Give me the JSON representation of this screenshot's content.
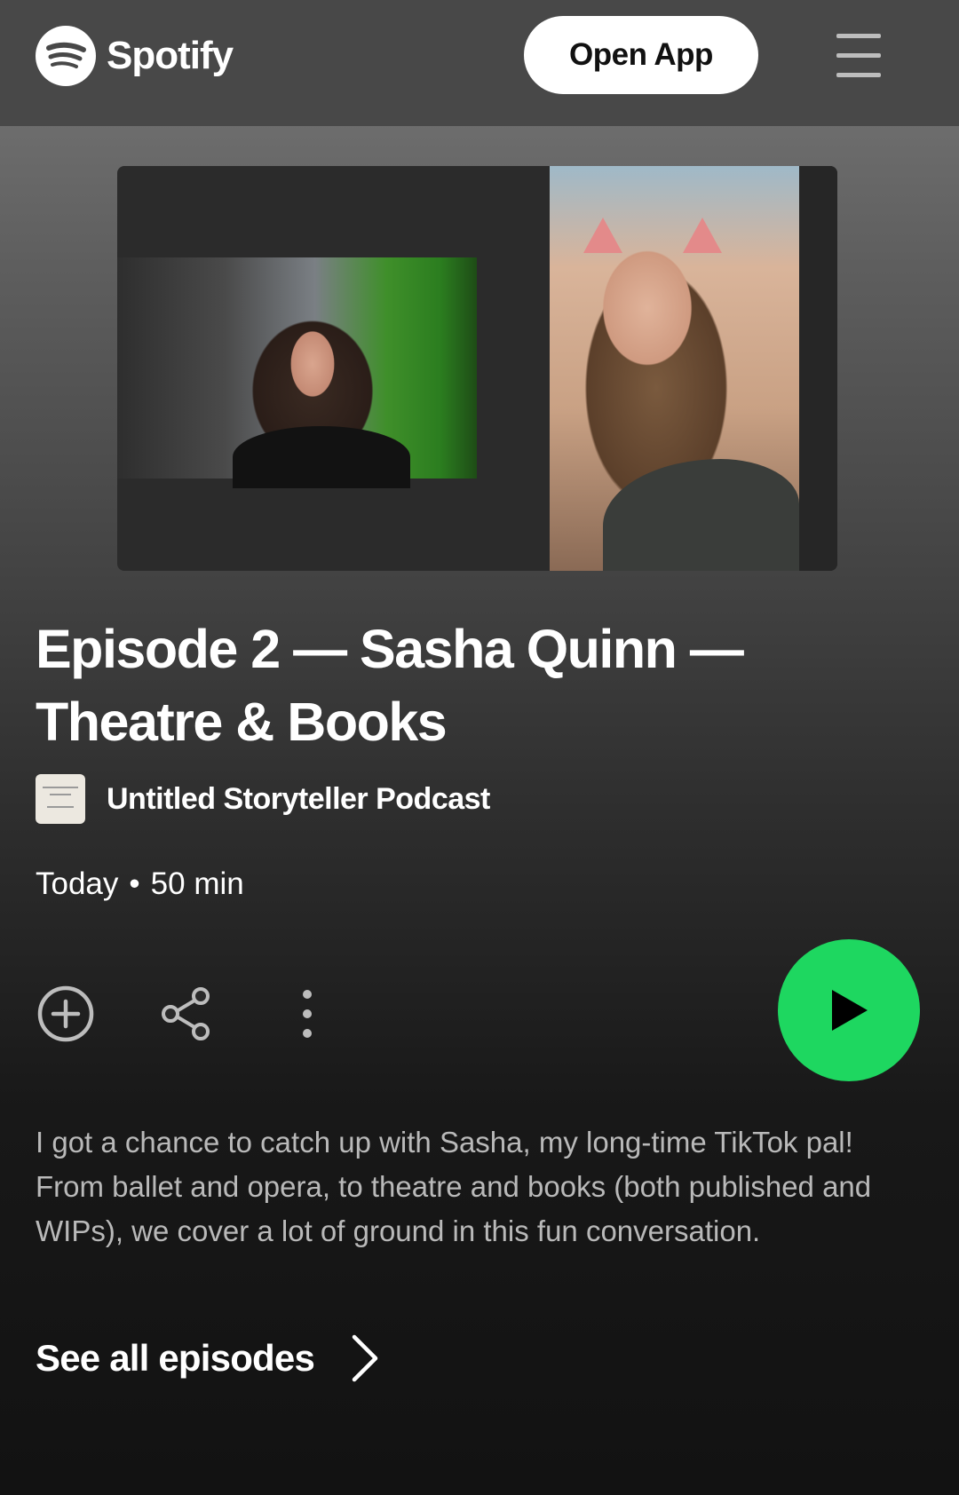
{
  "header": {
    "logo_text": "Spotify",
    "open_app_label": "Open App"
  },
  "episode": {
    "title": "Episode 2 — Sasha Quinn — Theatre & Books",
    "show_name": "Untitled Storyteller Podcast",
    "date": "Today",
    "separator": "•",
    "duration": "50 min",
    "description": "I got a chance to catch up with Sasha, my long-time TikTok pal! From ballet and opera, to theatre and books (both published and WIPs), we cover a lot of ground in this fun conversation."
  },
  "actions": {
    "add_icon": "plus-circle-icon",
    "share_icon": "share-icon",
    "more_icon": "more-vertical-icon",
    "play_icon": "play-icon"
  },
  "footer": {
    "see_all_label": "See all episodes"
  },
  "colors": {
    "accent_green": "#1ed760",
    "header_bg": "#484848",
    "description_text": "#b9b9b9"
  }
}
